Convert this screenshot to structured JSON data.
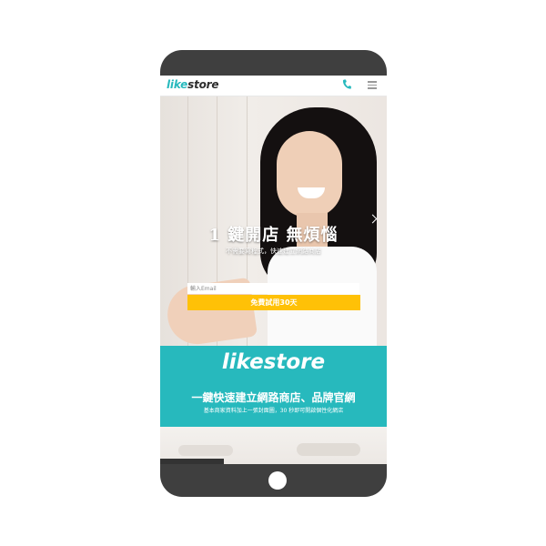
{
  "nav": {
    "logo_like": "like",
    "logo_store": "store",
    "icons": [
      "phone-icon",
      "menu-icon"
    ]
  },
  "hero": {
    "title": "1 鍵開店 無煩惱",
    "subtitle": "不需要寫程式，快速建立網路商店",
    "email_placeholder": "輸入Email",
    "cta_label": "免費試用30天"
  },
  "band": {
    "logo": "likestore",
    "title": "一鍵快速建立網路商店、品牌官網",
    "subtitle": "基本商家資料加上一張封面圖，30 秒即可開啟個性化網店"
  },
  "colors": {
    "brand_teal": "#27b9bd",
    "cta_yellow": "#ffc107",
    "frame": "#3f3f3f"
  }
}
